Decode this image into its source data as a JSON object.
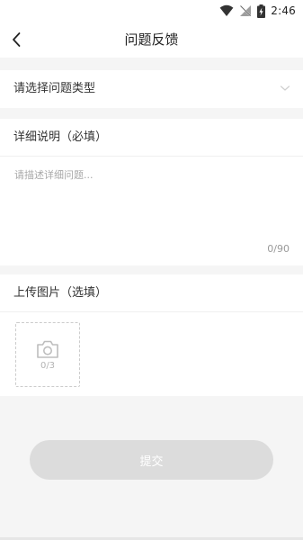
{
  "status_bar": {
    "time": "2:46",
    "icons": [
      "wifi-icon",
      "no-signal-icon",
      "battery-charging-icon"
    ]
  },
  "nav": {
    "title": "问题反馈",
    "back_icon": "chevron-left-icon"
  },
  "question_type": {
    "label": "请选择问题类型",
    "chevron_icon": "chevron-down-icon"
  },
  "detail": {
    "label": "详细说明（必填）",
    "placeholder": "请描述详细问题...",
    "value": "",
    "counter": "0/90"
  },
  "upload": {
    "label": "上传图片（选填）",
    "icon": "camera-icon",
    "count": "0/3"
  },
  "submit": {
    "label": "提交"
  },
  "colors": {
    "background": "#f5f5f5",
    "card": "#ffffff",
    "submit_disabled": "#dcdcdc",
    "placeholder": "#a8a8a8"
  }
}
